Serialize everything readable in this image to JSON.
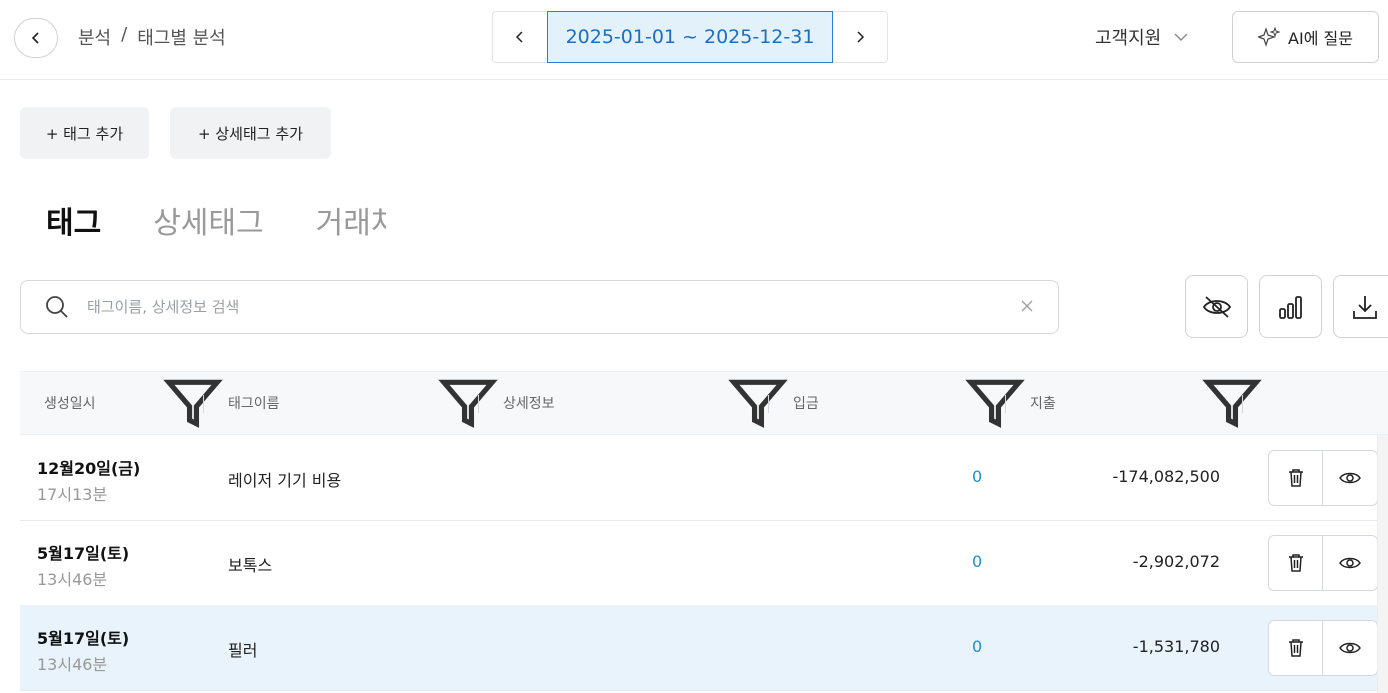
{
  "header": {
    "breadcrumb": [
      "분석",
      "/",
      "태그별 분석"
    ],
    "date_range": "2025-01-01 ~ 2025-12-31",
    "support_label": "고객지원",
    "ai_button_label": "AI에 질문"
  },
  "actions": {
    "add_tag": "+ 태그 추가",
    "add_detail_tag": "+ 상세태그 추가"
  },
  "tabs": [
    {
      "label": "태그",
      "active": true
    },
    {
      "label": "상세태그",
      "active": false
    },
    {
      "label": "거래처",
      "active": false
    }
  ],
  "search": {
    "placeholder": "태그이름, 상세정보 검색",
    "value": ""
  },
  "table": {
    "columns": [
      "생성일시",
      "태그이름",
      "상세정보",
      "입금",
      "지출"
    ],
    "rows": [
      {
        "date": "12월20일(금)",
        "time": "17시13분",
        "tag": "레이저 기기 비용",
        "detail": "",
        "deposit": "0",
        "expense": "-174,082,500",
        "highlighted": false
      },
      {
        "date": "5월17일(토)",
        "time": "13시46분",
        "tag": "보톡스",
        "detail": "",
        "deposit": "0",
        "expense": "-2,902,072",
        "highlighted": false
      },
      {
        "date": "5월17일(토)",
        "time": "13시46분",
        "tag": "필러",
        "detail": "",
        "deposit": "0",
        "expense": "-1,531,780",
        "highlighted": true
      }
    ]
  },
  "colors": {
    "accent": "#1b6fc1",
    "accent_bg": "#e3f1fb",
    "deposit": "#1b8fd1",
    "row_highlight": "#e8f3fc"
  },
  "icons": [
    "chevron-left-icon",
    "chevron-right-icon",
    "chevron-down-icon",
    "sparkle-icon",
    "search-icon",
    "clear-icon",
    "eye-off-icon",
    "bar-chart-icon",
    "download-icon",
    "filter-icon",
    "trash-icon",
    "eye-icon"
  ]
}
